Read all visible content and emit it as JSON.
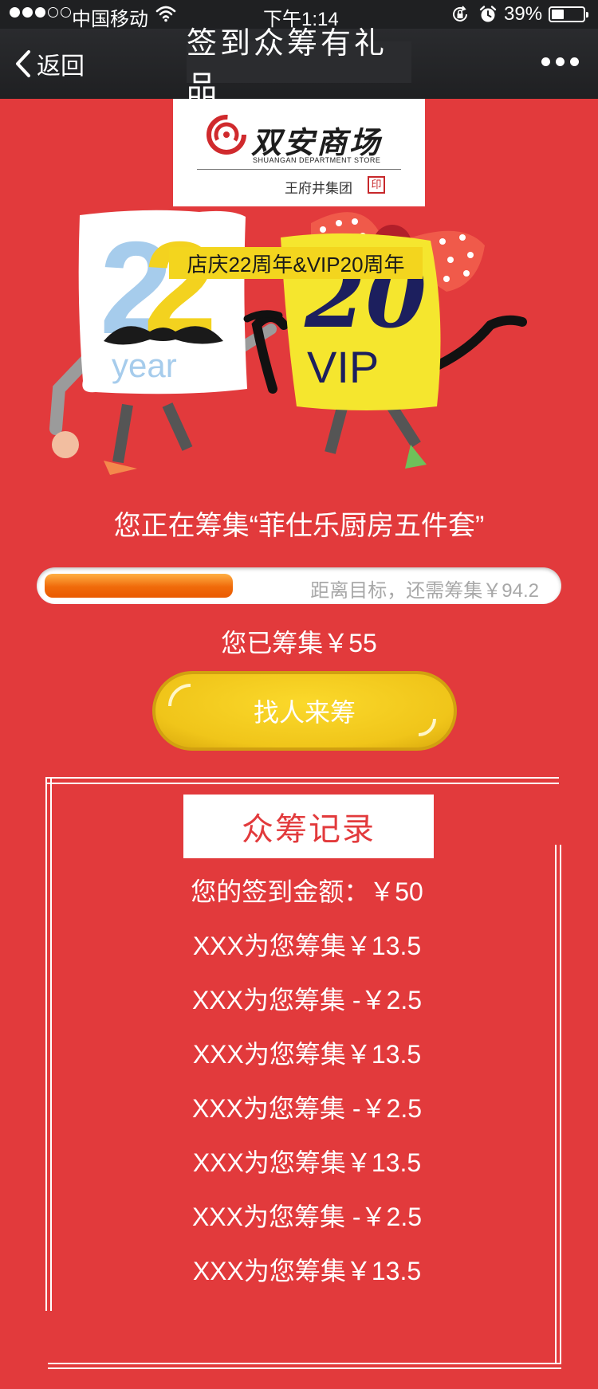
{
  "status_bar": {
    "carrier": "中国移动",
    "time": "下午1:14",
    "battery_percent": "39%",
    "battery_level": 0.39,
    "signal_bars_filled": 3,
    "signal_bars_total": 5,
    "icons": [
      "signal-dots-icon",
      "wifi-icon",
      "rotation-lock-icon",
      "alarm-icon",
      "battery-icon"
    ]
  },
  "nav": {
    "back_label": "返回",
    "title": "签到众筹有礼品",
    "more_icon": "more-dots-icon"
  },
  "logo": {
    "name": "双安商场",
    "subtitle": "SHUANGAN DEPARTMENT STORE",
    "group": "王府井集团"
  },
  "hero": {
    "year_number": "22",
    "year_word": "year",
    "vip_number": "20",
    "vip_word": "VIP",
    "banner": "店庆22周年&VIP20周年"
  },
  "collecting": {
    "title": "您正在筹集“菲仕乐厨房五件套”",
    "progress_text": "距离目标，还需筹集￥94.2",
    "progress_fraction": 0.37,
    "collected_text": "您已筹集￥55"
  },
  "find_button_label": "找人来筹",
  "records": {
    "title": "众筹记录",
    "items": [
      "您的签到金额：￥50",
      "XXX为您筹集￥13.5",
      "XXX为您筹集 -￥2.5",
      "XXX为您筹集￥13.5",
      "XXX为您筹集 -￥2.5",
      "XXX为您筹集￥13.5",
      "XXX为您筹集 -￥2.5",
      "XXX为您筹集￥13.5"
    ]
  },
  "colors": {
    "background": "#e23a3c",
    "nav_bar": "#1f2022",
    "button_yellow": "#f0c51a",
    "progress_orange": "#f06a0a"
  }
}
